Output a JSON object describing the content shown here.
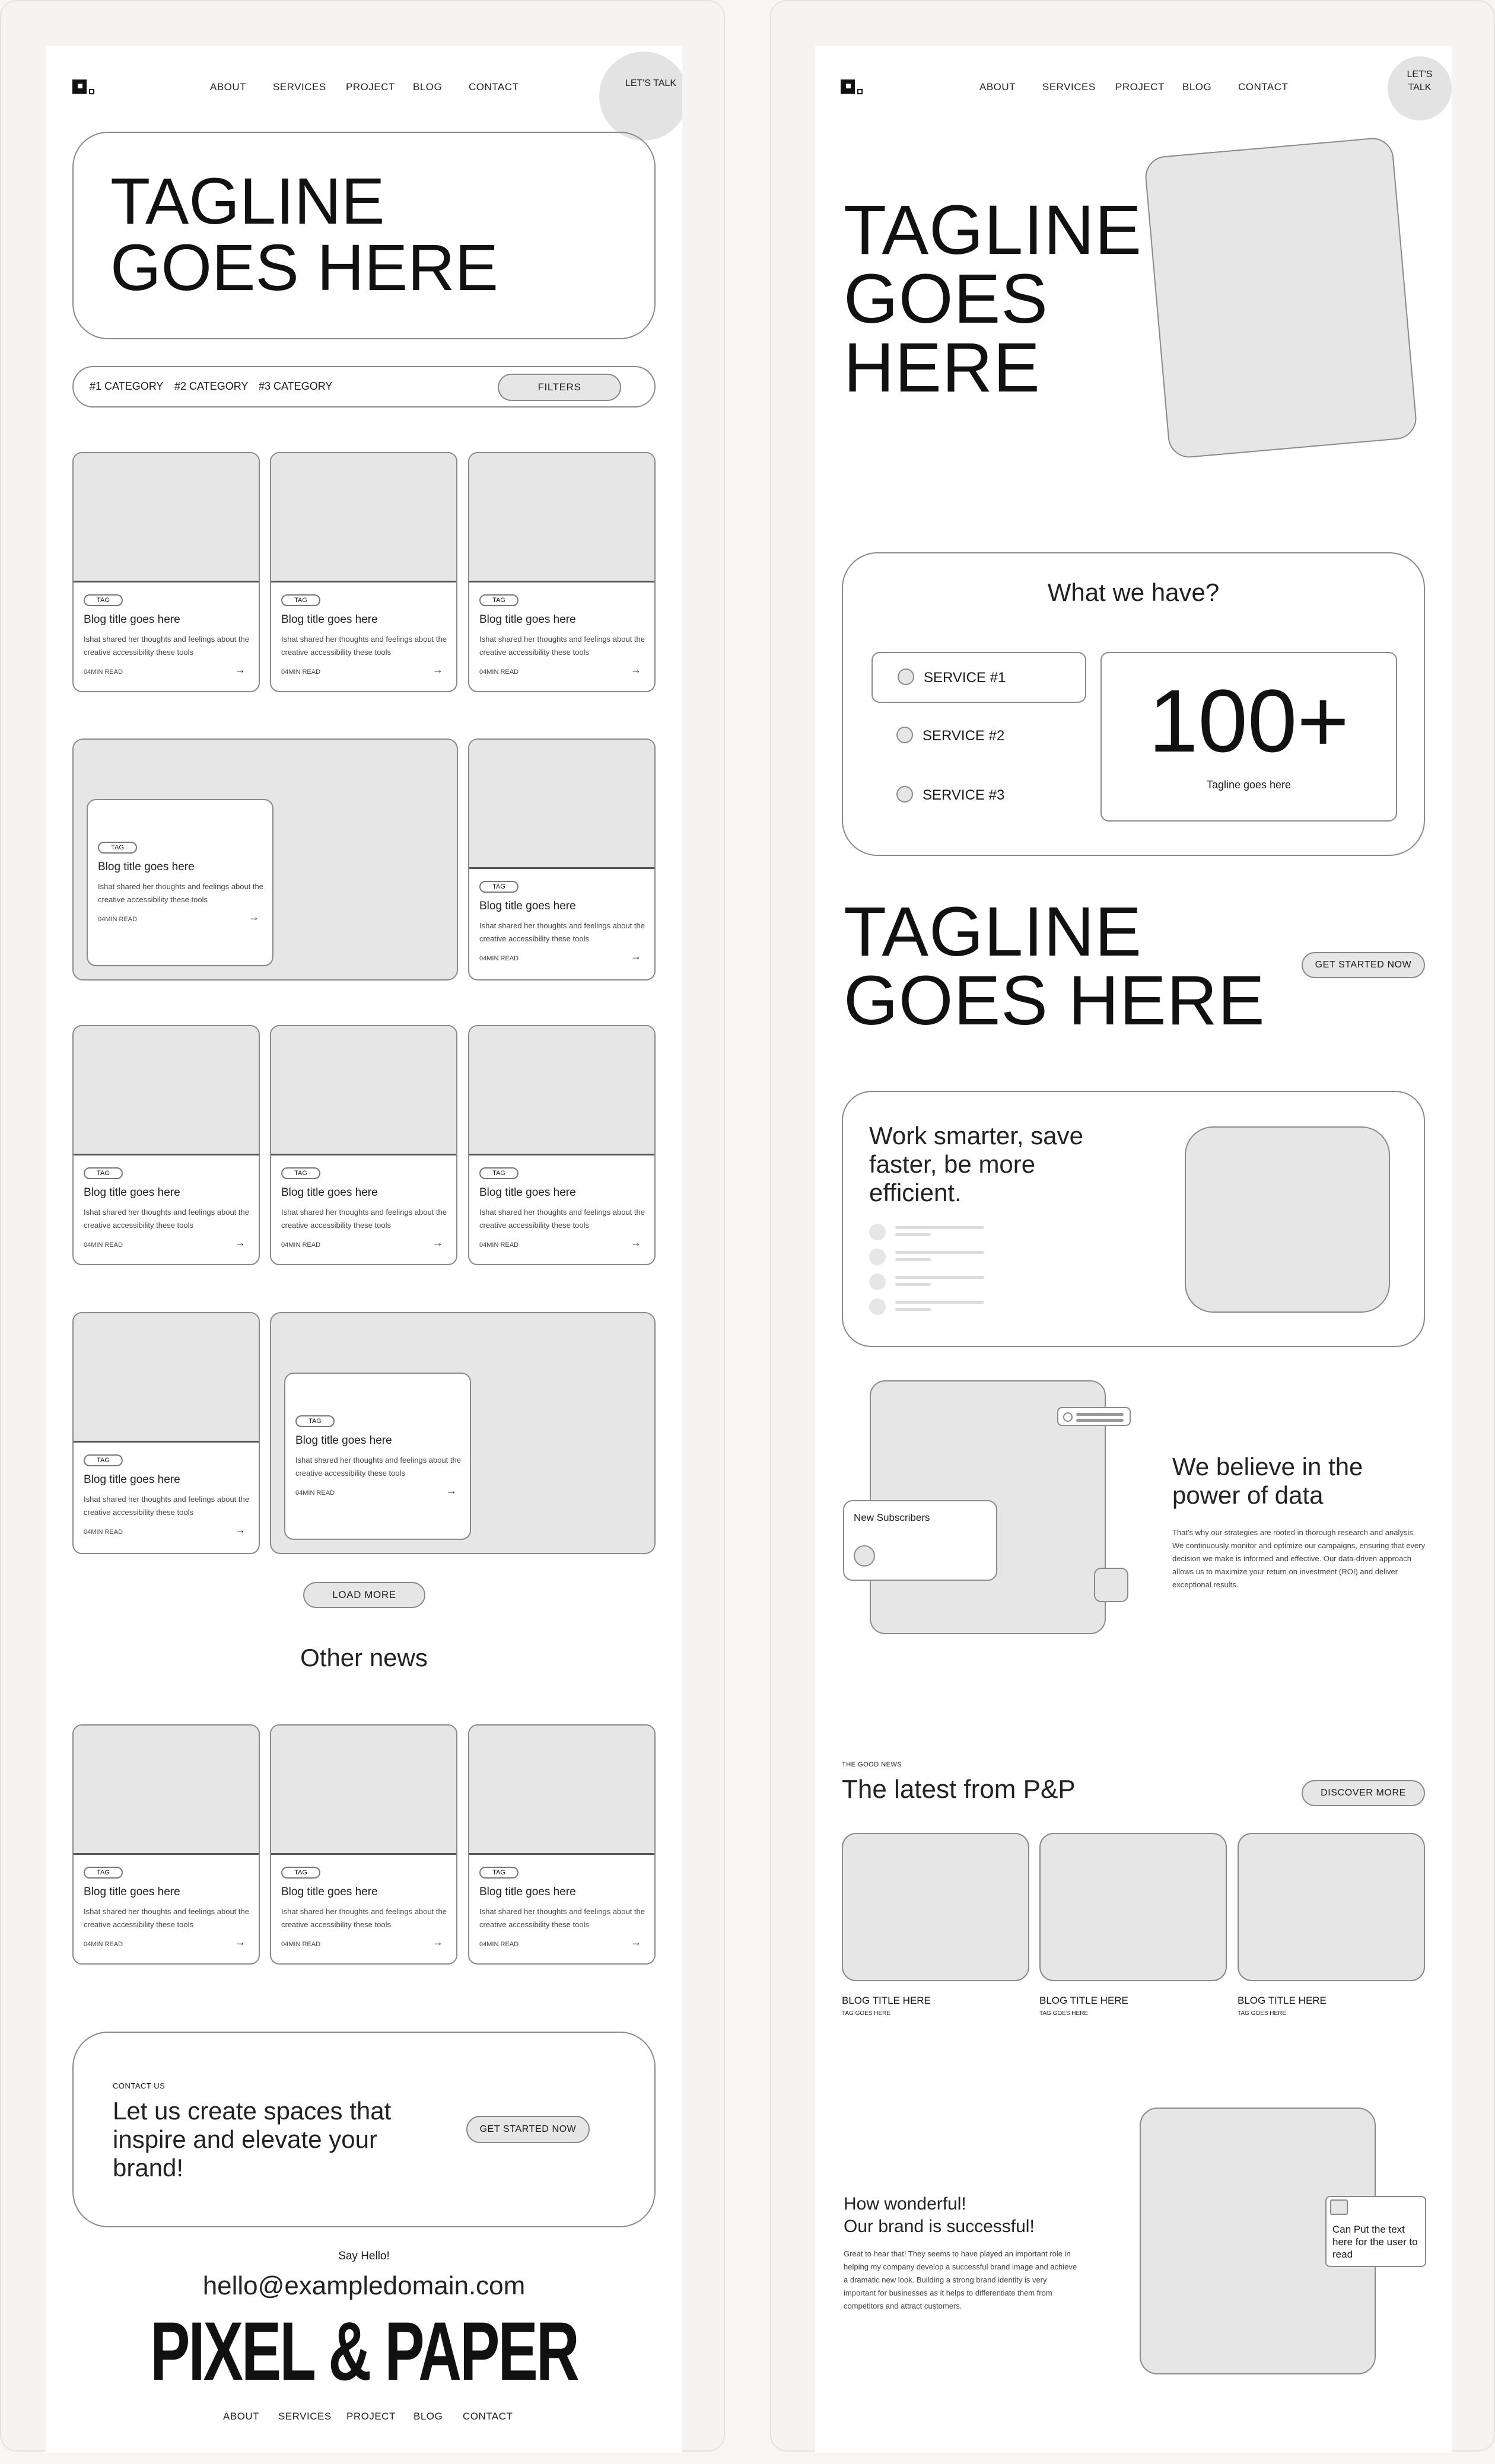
{
  "nav": {
    "links": [
      "ABOUT",
      "SERVICES",
      "PROJECT",
      "BLOG",
      "CONTACT"
    ],
    "cta_line1": "LET'S",
    "cta_line2": "TALK",
    "cta_single": "LET'S TALK"
  },
  "left": {
    "hero": {
      "line1": "TAGLINE",
      "line2": "GOES HERE"
    },
    "filters": {
      "categories": [
        "#1 CATEGORY",
        "#2 CATEGORY",
        "#3 CATEGORY"
      ],
      "button": "FILTERS"
    },
    "card": {
      "tag": "TAG",
      "title": "Blog title goes here",
      "desc": "Ishat shared her thoughts and feelings about the creative accessibility these tools",
      "read": "04MIN READ",
      "arrow": "→"
    },
    "load_more": "LOAD MORE",
    "other_news": "Other news",
    "contact": {
      "label": "CONTACT US",
      "heading": "Let us create spaces that inspire and elevate your brand!",
      "button": "GET STARTED NOW"
    },
    "footer": {
      "say_hello": "Say Hello!",
      "email": "hello@exampledomain.com",
      "brand": "PIXEL & PAPER",
      "links": [
        "ABOUT",
        "SERVICES",
        "PROJECT",
        "BLOG",
        "CONTACT"
      ]
    }
  },
  "right": {
    "hero": {
      "line1": "TAGLINE",
      "line2": "GOES",
      "line3": "HERE"
    },
    "services": {
      "title": "What we have?",
      "items": [
        "SERVICE #1",
        "SERVICE #2",
        "SERVICE #3"
      ],
      "stat": "100+",
      "stat_label": "Tagline goes here"
    },
    "tagline2": {
      "line1": "TAGLINE",
      "line2": "GOES HERE",
      "button": "GET STARTED NOW"
    },
    "work": {
      "heading": "Work smarter, save faster, be more efficient."
    },
    "data": {
      "subscribers": "New Subscribers",
      "heading": "We believe in the power of data",
      "body": "That's why our strategies are rooted in thorough research and analysis. We continuously monitor and optimize our campaigns, ensuring that every decision we make is informed and effective. Our data-driven approach allows us to maximize your return on investment (ROI) and deliver exceptional results."
    },
    "latest": {
      "eyebrow": "THE GOOD NEWS",
      "title": "The latest from P&P",
      "button": "DISCOVER MORE",
      "blog_title": "BLOG TITLE HERE",
      "blog_tag": "TAG GOES HERE"
    },
    "wonder": {
      "line1": "How wonderful!",
      "line2": "Our brand is successful!",
      "body": "Great to hear that! They seems to have played an important role in helping my company develop a successful brand image and achieve a dramatic new look. Building a strong brand identity is very important for businesses as it helps to differentiate them from competitors and attract customers.",
      "note": "Can Put the text here for the user to read"
    }
  },
  "colors": {
    "outline": "#8a8a8a",
    "placeholder": "#e6e6e6",
    "text": "#1a1a1a"
  }
}
